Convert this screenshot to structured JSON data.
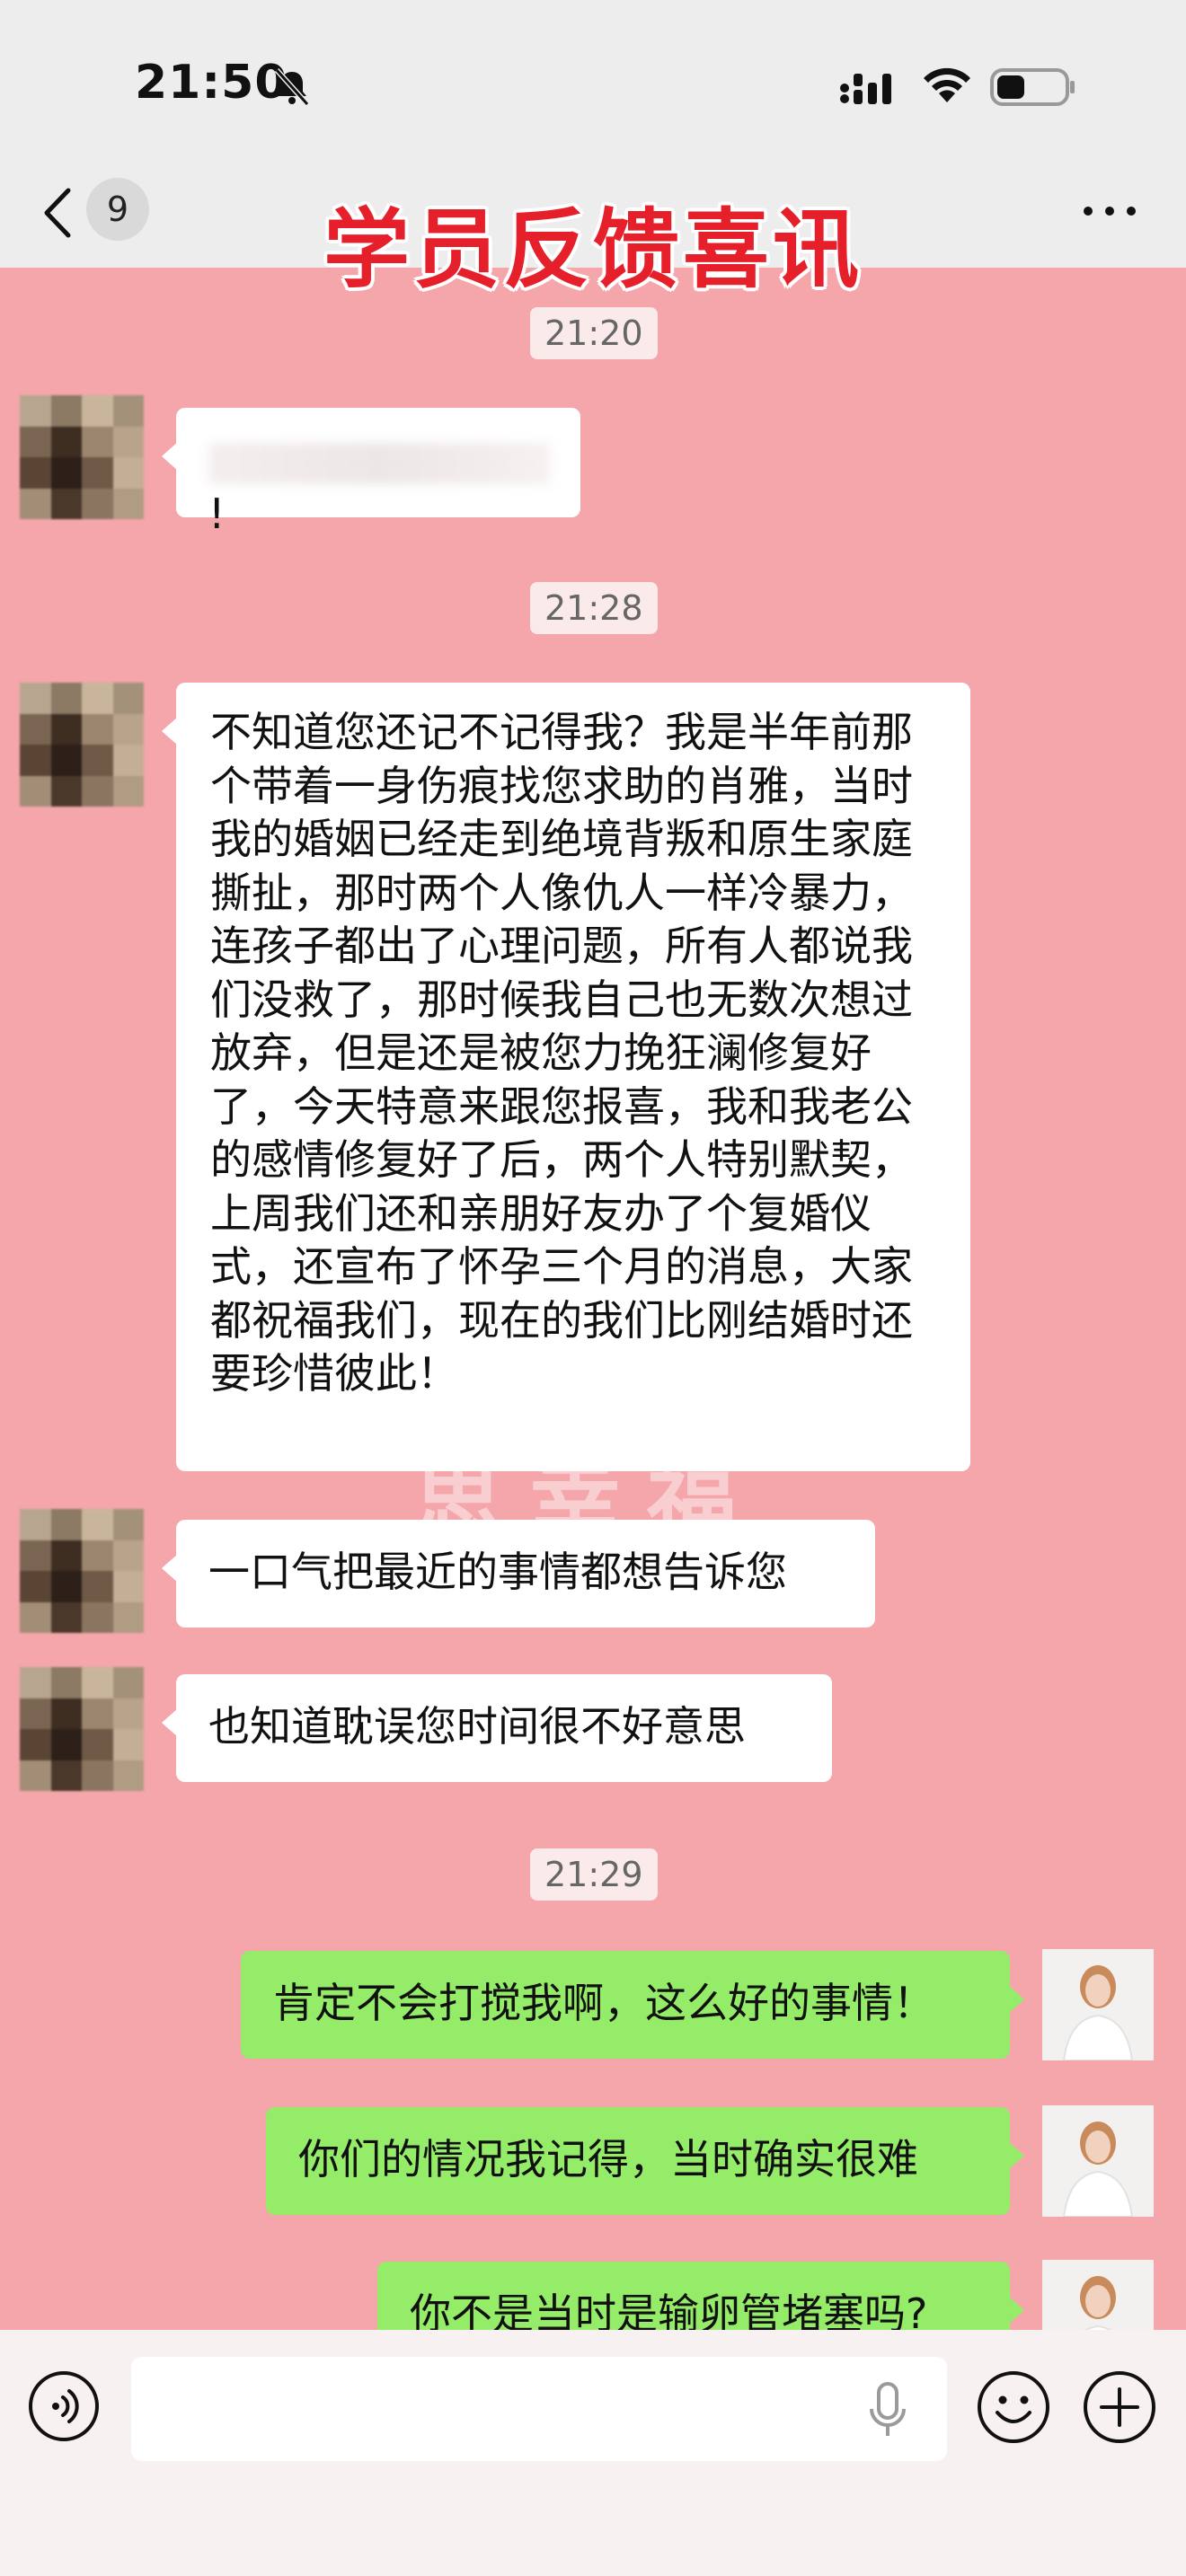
{
  "status_bar": {
    "time": "21:50"
  },
  "nav": {
    "unread_count": "9",
    "title": "学员反馈喜讯"
  },
  "watermark": "思幸福",
  "messages": {
    "time1": "21:20",
    "m1_suffix": "!",
    "time2": "21:28",
    "m2": "不知道您还记不记得我？我是半年前那个带着一身伤痕找您求助的肖雅，当时我的婚姻已经走到绝境背叛和原生家庭撕扯，那时两个人像仇人一样冷暴力，连孩子都出了心理问题，所有人都说我们没救了，那时候我自己也无数次想过放弃，但是还是被您力挽狂澜修复好了，今天特意来跟您报喜，我和我老公的感情修复好了后，两个人特别默契，上周我们还和亲朋好友办了个复婚仪式，还宣布了怀孕三个月的消息，大家都祝福我们，现在的我们比刚结婚时还要珍惜彼此！",
    "m3": "一口气把最近的事情都想告诉您",
    "m4": "也知道耽误您时间很不好意思",
    "time3": "21:29",
    "r1": "肯定不会打搅我啊，这么好的事情！",
    "r2": "你们的情况我记得，当时确实很难",
    "r3": "你不是当时是输卵管堵塞吗?"
  },
  "input": {
    "placeholder": ""
  }
}
